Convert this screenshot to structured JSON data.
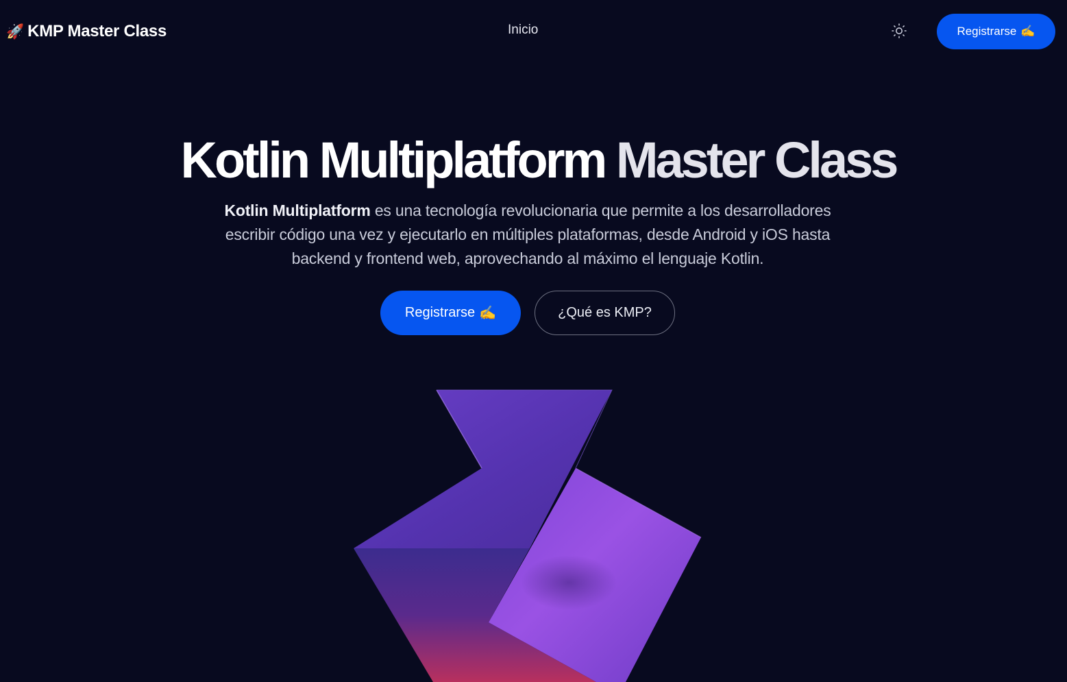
{
  "header": {
    "brand_icon": "🚀",
    "brand_text": "KMP Master Class",
    "nav": [
      {
        "label": "Inicio"
      }
    ],
    "theme_toggle_icon": "sun-icon",
    "cta_label": "Registrarse",
    "cta_icon": "✍️"
  },
  "hero": {
    "title_part1": "Kotlin Multiplatform",
    "title_part2": "Master Class",
    "description_bold": "Kotlin Multiplatform",
    "description_rest": " es una tecnología revolucionaria que permite a los desarrolladores escribir código una vez y ejecutarlo en múltiples plataformas, desde Android y iOS hasta backend y frontend web, aprovechando al máximo el lenguaje Kotlin.",
    "primary_button": "Registrarse",
    "primary_button_icon": "✍️",
    "secondary_button": "¿Qué es KMP?"
  },
  "colors": {
    "background": "#080a1f",
    "accent": "#0656f0",
    "title_secondary": "#e4e4ec",
    "art_purple": "#8b4fe0",
    "art_pink": "#c2306e"
  }
}
